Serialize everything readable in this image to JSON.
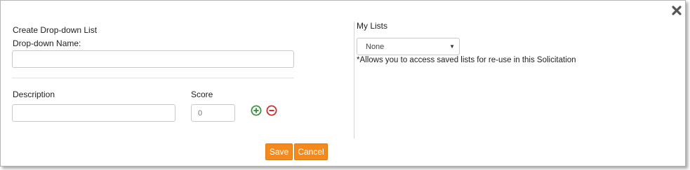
{
  "dialog": {
    "close_icon": "close-x-icon"
  },
  "create_list": {
    "heading": "Create Drop-down List",
    "name_label": "Drop-down Name:",
    "name_value": "",
    "description_label": "Description",
    "description_value": "",
    "score_label": "Score",
    "score_placeholder": "0",
    "add_icon": "plus-circle-icon",
    "remove_icon": "minus-circle-icon"
  },
  "my_lists": {
    "label": "My Lists",
    "selected": "None",
    "hint": "*Allows you to access saved lists for re-use in this Solicitation"
  },
  "actions": {
    "save_label": "Save",
    "cancel_label": "Cancel"
  },
  "colors": {
    "accent": "#f28a1f",
    "add": "#3f9142",
    "remove": "#c9302c"
  }
}
